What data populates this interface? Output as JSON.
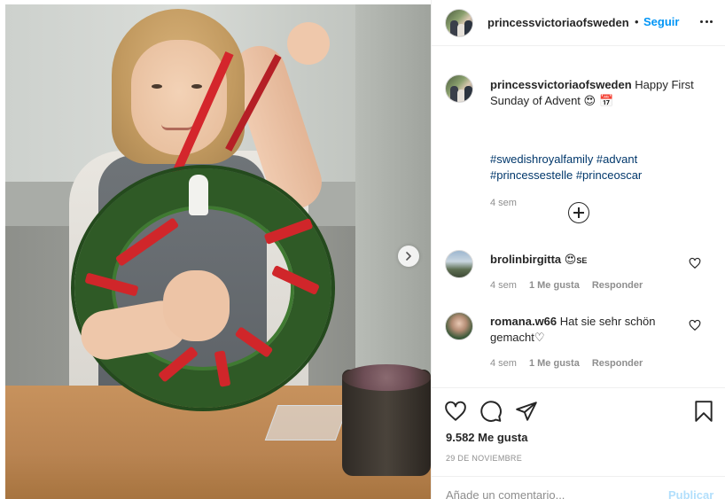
{
  "post": {
    "username": "princessvictoriaofsweden",
    "separator": "•",
    "follow_label": "Seguir",
    "caption": "Happy First Sunday of Advent",
    "caption_emojis": "😍 📅",
    "hashtags": "#swedishroyalfamily #advant #princessestelle #princeoscar",
    "caption_time": "4 sem",
    "likes": "9.582 Me gusta",
    "date": "29 DE NOVIEMBRE"
  },
  "comments": [
    {
      "username": "brolinbirgitta",
      "text": "",
      "emojis": "😍",
      "flag": "SE",
      "time": "4 sem",
      "likes": "1 Me gusta",
      "reply": "Responder"
    },
    {
      "username": "romana.w66",
      "text": "Hat sie sehr schön gemacht",
      "emojis": "♡",
      "flag": "",
      "time": "4 sem",
      "likes": "1 Me gusta",
      "reply": "Responder"
    }
  ],
  "add_comment": {
    "placeholder": "Añade un comentario...",
    "publish_label": "Publicar"
  },
  "icons": {
    "more": "more-options-icon",
    "next": "chevron-right-icon",
    "like": "heart-icon",
    "comment": "comment-bubble-icon",
    "share": "paper-plane-icon",
    "save": "bookmark-icon",
    "load_more": "plus-circle-icon"
  },
  "colors": {
    "link": "#0095f6",
    "hashtag": "#00376b",
    "muted": "#8e8e8e",
    "publish_disabled": "#b2dffc"
  }
}
